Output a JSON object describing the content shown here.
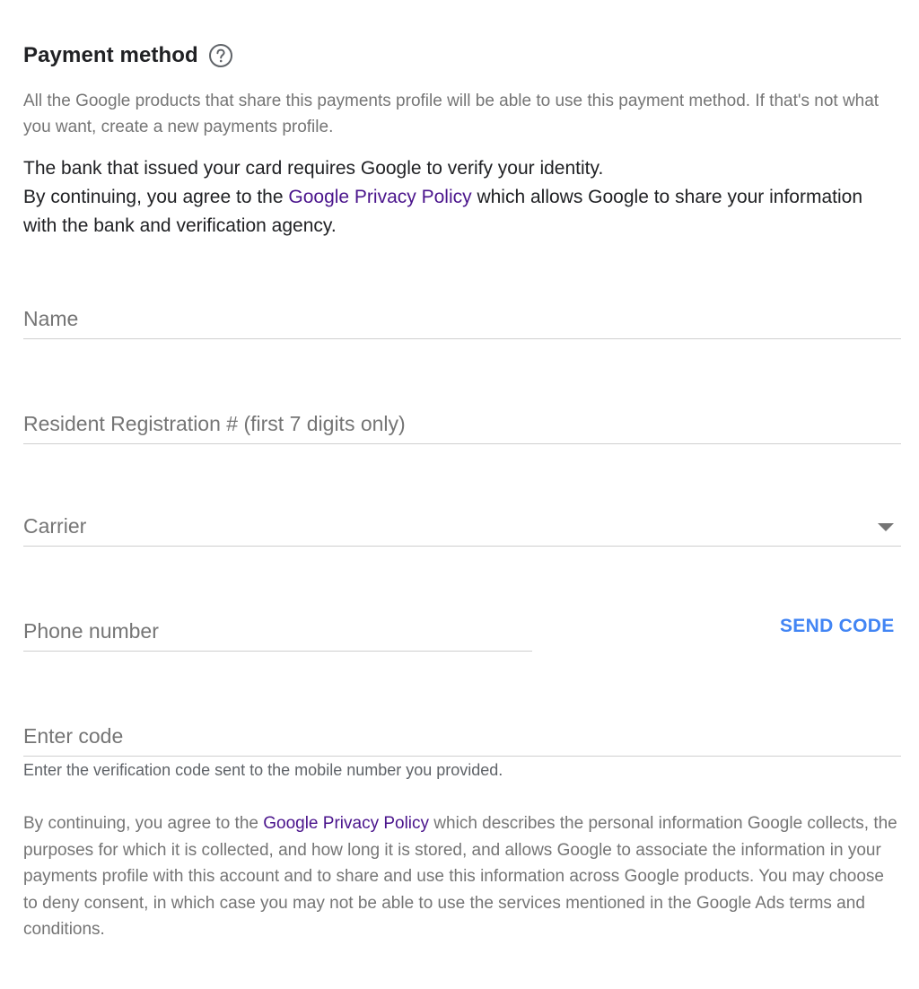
{
  "header": {
    "title": "Payment method",
    "help_icon": "help-circle-icon"
  },
  "subtitle": "All the Google products that share this payments profile will be able to use this payment method. If that's not what you want, create a new payments profile.",
  "verify": {
    "line1": "The bank that issued your card requires Google to verify your identity.",
    "line2_prefix": "By continuing, you agree to the ",
    "link": "Google Privacy Policy",
    "line2_suffix": " which allows Google to share your information with the bank and verification agency."
  },
  "fields": {
    "name": {
      "placeholder": "Name",
      "value": ""
    },
    "resident": {
      "placeholder": "Resident Registration # (first 7 digits only)",
      "value": ""
    },
    "carrier": {
      "label": "Carrier",
      "icon": "dropdown-arrow-icon"
    },
    "phone": {
      "placeholder": "Phone number",
      "value": ""
    },
    "code": {
      "placeholder": "Enter code",
      "value": ""
    }
  },
  "send_code_label": "SEND CODE",
  "helper_text": "Enter the verification code sent to the mobile number you provided.",
  "consent": {
    "prefix": "By continuing, you agree to the ",
    "link": "Google Privacy Policy",
    "suffix": " which describes the personal information Google collects, the purposes for which it is collected, and how long it is stored, and allows Google to associate the information in your payments profile with this account and to share and use this information across Google products. You may choose to deny consent, in which case you may not be able to use the services mentioned in the Google Ads terms and conditions."
  },
  "colors": {
    "link": "#4a148c",
    "accent": "#4285f4",
    "muted": "#757575"
  }
}
